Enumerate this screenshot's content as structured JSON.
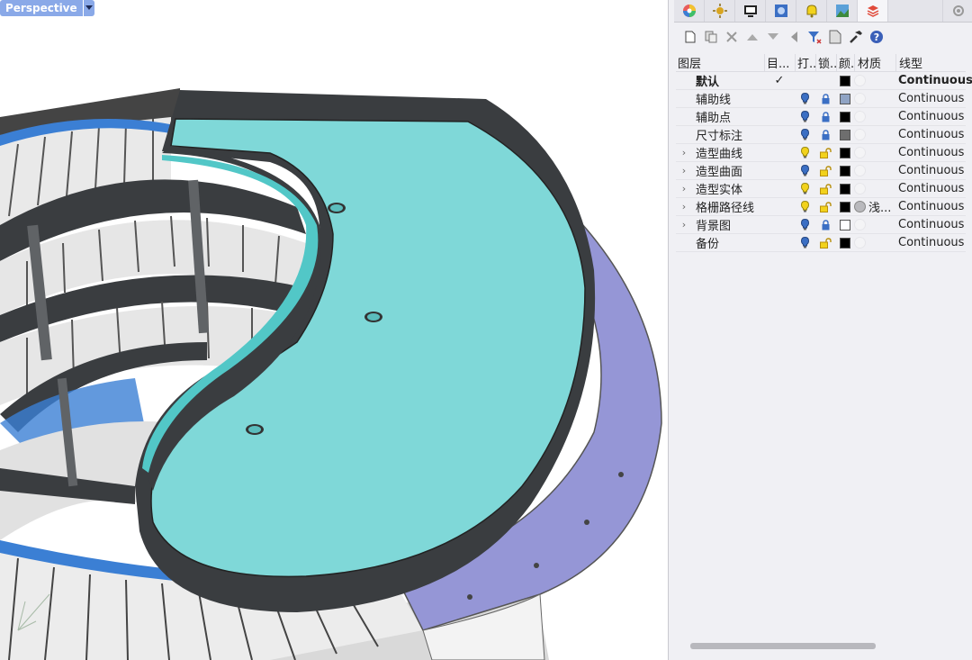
{
  "viewport": {
    "label": "Perspective"
  },
  "panel": {
    "tab_icons": [
      "color-wheel-icon",
      "light-icon",
      "display-icon",
      "rendering-icon",
      "notification-icon",
      "environment-icon",
      "layers-icon",
      "settings-icon"
    ],
    "toolbar_icons": [
      "new-layer-icon",
      "new-sublayer-icon",
      "delete-icon",
      "move-up-icon",
      "move-down-icon",
      "move-left-icon",
      "filter-icon",
      "layer-state-icon",
      "tools-icon",
      "help-icon"
    ],
    "columns": {
      "name": "图层",
      "current": "目...",
      "visible": "打...",
      "lock": "锁...",
      "color": "颜...",
      "material": "材质",
      "linetype": "线型"
    },
    "layers": [
      {
        "name": "默认",
        "current_mark": "✓",
        "expandable": false,
        "has_icons": false,
        "color": "#000000",
        "material": "",
        "linetype": "Continuous",
        "bulb": "",
        "lock": ""
      },
      {
        "name": "辅助线",
        "current_mark": "",
        "expandable": false,
        "has_icons": true,
        "color": "#8fa3c4",
        "material": "",
        "linetype": "Continuous",
        "bulb": "off",
        "lock": "locked"
      },
      {
        "name": "辅助点",
        "current_mark": "",
        "expandable": false,
        "has_icons": true,
        "color": "#000000",
        "material": "",
        "linetype": "Continuous",
        "bulb": "off",
        "lock": "locked"
      },
      {
        "name": "尺寸标注",
        "current_mark": "",
        "expandable": false,
        "has_icons": true,
        "color": "#6e6e6e",
        "material": "",
        "linetype": "Continuous",
        "bulb": "off",
        "lock": "locked"
      },
      {
        "name": "造型曲线",
        "current_mark": "",
        "expandable": true,
        "has_icons": true,
        "color": "#000000",
        "material": "",
        "linetype": "Continuous",
        "bulb": "on",
        "lock": "unlocked"
      },
      {
        "name": "造型曲面",
        "current_mark": "",
        "expandable": true,
        "has_icons": true,
        "color": "#000000",
        "material": "",
        "linetype": "Continuous",
        "bulb": "off",
        "lock": "unlocked"
      },
      {
        "name": "造型实体",
        "current_mark": "",
        "expandable": true,
        "has_icons": true,
        "color": "#000000",
        "material": "",
        "linetype": "Continuous",
        "bulb": "on",
        "lock": "unlocked"
      },
      {
        "name": "格栅路径线",
        "current_mark": "",
        "expandable": true,
        "has_icons": true,
        "color": "#000000",
        "material": "浅...",
        "linetype": "Continuous",
        "bulb": "on",
        "lock": "unlocked"
      },
      {
        "name": "背景图",
        "current_mark": "",
        "expandable": true,
        "has_icons": true,
        "color": "#ffffff",
        "material": "",
        "linetype": "Continuous",
        "bulb": "off",
        "lock": "locked"
      },
      {
        "name": "备份",
        "current_mark": "",
        "expandable": false,
        "has_icons": true,
        "color": "#000000",
        "material": "",
        "linetype": "Continuous",
        "bulb": "off",
        "lock": "unlocked"
      }
    ]
  },
  "colors": {
    "viewport_tab": "#8aa9e8",
    "platform_top": "#7fd8d8",
    "ring_band": "#9596d6",
    "wall_dark": "#3a3d40",
    "accent_blue": "#3b7fd4"
  }
}
